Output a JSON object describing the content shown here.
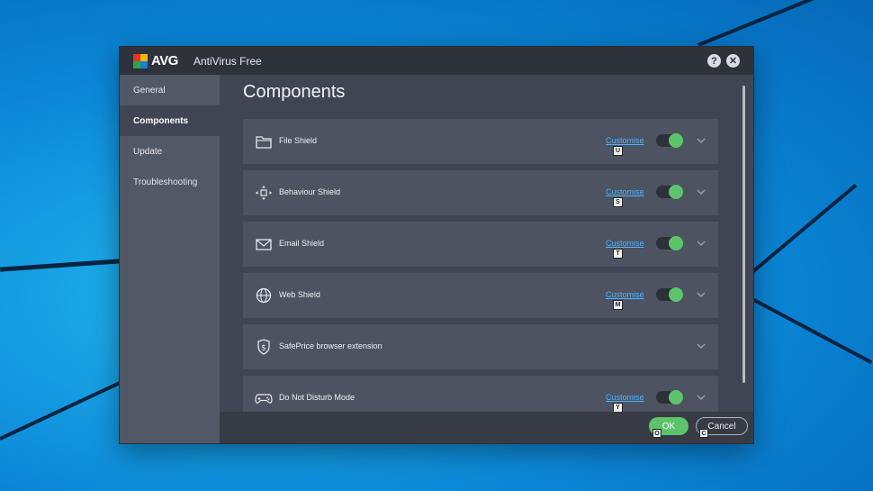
{
  "window": {
    "brand": "AVG",
    "title": "AntiVirus Free",
    "help_label": "?",
    "close_label": "✕"
  },
  "sidebar": {
    "items": [
      {
        "label": "General"
      },
      {
        "label": "Components"
      },
      {
        "label": "Update"
      },
      {
        "label": "Troubleshooting"
      }
    ]
  },
  "main": {
    "title": "Components",
    "components": [
      {
        "name": "File Shield",
        "icon": "folder-icon",
        "customise": "Customise",
        "hotkey": "U",
        "enabled": true
      },
      {
        "name": "Behaviour Shield",
        "icon": "move-arrows-icon",
        "customise": "Customise",
        "hotkey": "S",
        "enabled": true
      },
      {
        "name": "Email Shield",
        "icon": "envelope-icon",
        "customise": "Customise",
        "hotkey": "T",
        "enabled": true
      },
      {
        "name": "Web Shield",
        "icon": "globe-icon",
        "customise": "Customise",
        "hotkey": "M",
        "enabled": true
      },
      {
        "name": "SafePrice browser extension",
        "icon": "dollar-shield-icon"
      },
      {
        "name": "Do Not Disturb Mode",
        "icon": "gamepad-icon",
        "customise": "Customise",
        "hotkey": "Y",
        "enabled": true
      }
    ]
  },
  "footer": {
    "ok_label": "OK",
    "ok_hotkey": "O",
    "cancel_label": "Cancel",
    "cancel_hotkey": "C"
  },
  "colors": {
    "accent_green": "#5ec46b",
    "link_blue": "#4fb4ff",
    "window_bg": "#3f4553",
    "sidebar_bg": "#515866"
  }
}
